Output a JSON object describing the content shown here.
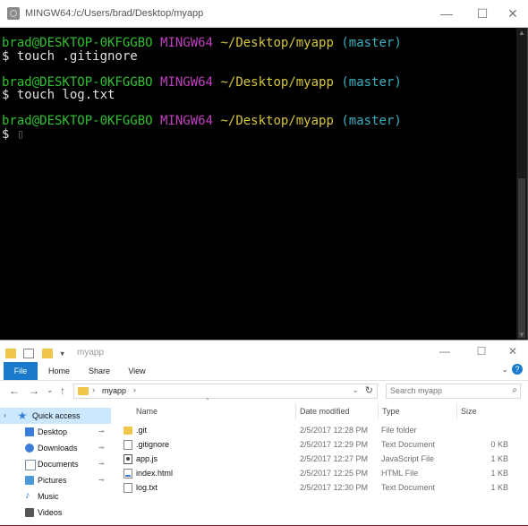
{
  "terminal": {
    "title": "MINGW64:/c/Users/brad/Desktop/myapp",
    "controls": {
      "minimize": "—",
      "maximize": "☐",
      "close": "✕"
    },
    "prompts": [
      {
        "userhost": "brad@DESKTOP-0KFGGBO",
        "env": "MINGW64",
        "path": "~/Desktop/myapp",
        "branch": "(master)",
        "command": "$ touch .gitignore"
      },
      {
        "userhost": "brad@DESKTOP-0KFGGBO",
        "env": "MINGW64",
        "path": "~/Desktop/myapp",
        "branch": "(master)",
        "command": "$ touch log.txt"
      },
      {
        "userhost": "brad@DESKTOP-0KFGGBO",
        "env": "MINGW64",
        "path": "~/Desktop/myapp",
        "branch": "(master)",
        "command": "$ "
      }
    ],
    "cursor": "▯"
  },
  "explorer": {
    "title": "myapp",
    "controls": {
      "minimize": "—",
      "maximize": "☐",
      "close": "✕"
    },
    "qat_dropdown": "▾",
    "ribbon_tabs": [
      "File",
      "Home",
      "Share",
      "View"
    ],
    "ribbon_expand": "⌄",
    "ribbon_help": "?",
    "nav": {
      "back": "←",
      "forward": "→",
      "dropdown": "⌄",
      "up": "↑"
    },
    "address": {
      "sep": "›",
      "crumb": "myapp",
      "dropdown": "⌄",
      "refresh": "↻"
    },
    "search": {
      "placeholder": "Search myapp",
      "icon": "⌕"
    },
    "nav_pane": {
      "quick_chev": "›",
      "items": [
        {
          "label": "Quick access",
          "icon": "star-icon",
          "color": "#3b7dd8"
        },
        {
          "label": "Desktop",
          "icon": "desktop-icon",
          "color": "#3b7dd8",
          "pin": "📌"
        },
        {
          "label": "Downloads",
          "icon": "download-icon",
          "color": "#3b7dd8",
          "pin": "📌"
        },
        {
          "label": "Documents",
          "icon": "documents-icon",
          "color": "#7a8fa6",
          "pin": "📌"
        },
        {
          "label": "Pictures",
          "icon": "pictures-icon",
          "color": "#4a9ad6",
          "pin": "📌"
        },
        {
          "label": "Music",
          "icon": "music-icon",
          "color": "#3b7dd8"
        },
        {
          "label": "Videos",
          "icon": "videos-icon",
          "color": "#555"
        }
      ]
    },
    "columns": {
      "sort": "^",
      "name": "Name",
      "date": "Date modified",
      "type": "Type",
      "size": "Size"
    },
    "files": [
      {
        "name": ".git",
        "date": "2/5/2017 12:28 PM",
        "type": "File folder",
        "size": "",
        "icon": "folder-icon"
      },
      {
        "name": ".gitignore",
        "date": "2/5/2017 12:29 PM",
        "type": "Text Document",
        "size": "0 KB",
        "icon": "document-icon"
      },
      {
        "name": "app.js",
        "date": "2/5/2017 12:27 PM",
        "type": "JavaScript File",
        "size": "1 KB",
        "icon": "javascript-file-icon"
      },
      {
        "name": "index.html",
        "date": "2/5/2017 12:25 PM",
        "type": "HTML File",
        "size": "1 KB",
        "icon": "html-file-icon"
      },
      {
        "name": "log.txt",
        "date": "2/5/2017 12:30 PM",
        "type": "Text Document",
        "size": "1 KB",
        "icon": "document-icon"
      }
    ]
  }
}
